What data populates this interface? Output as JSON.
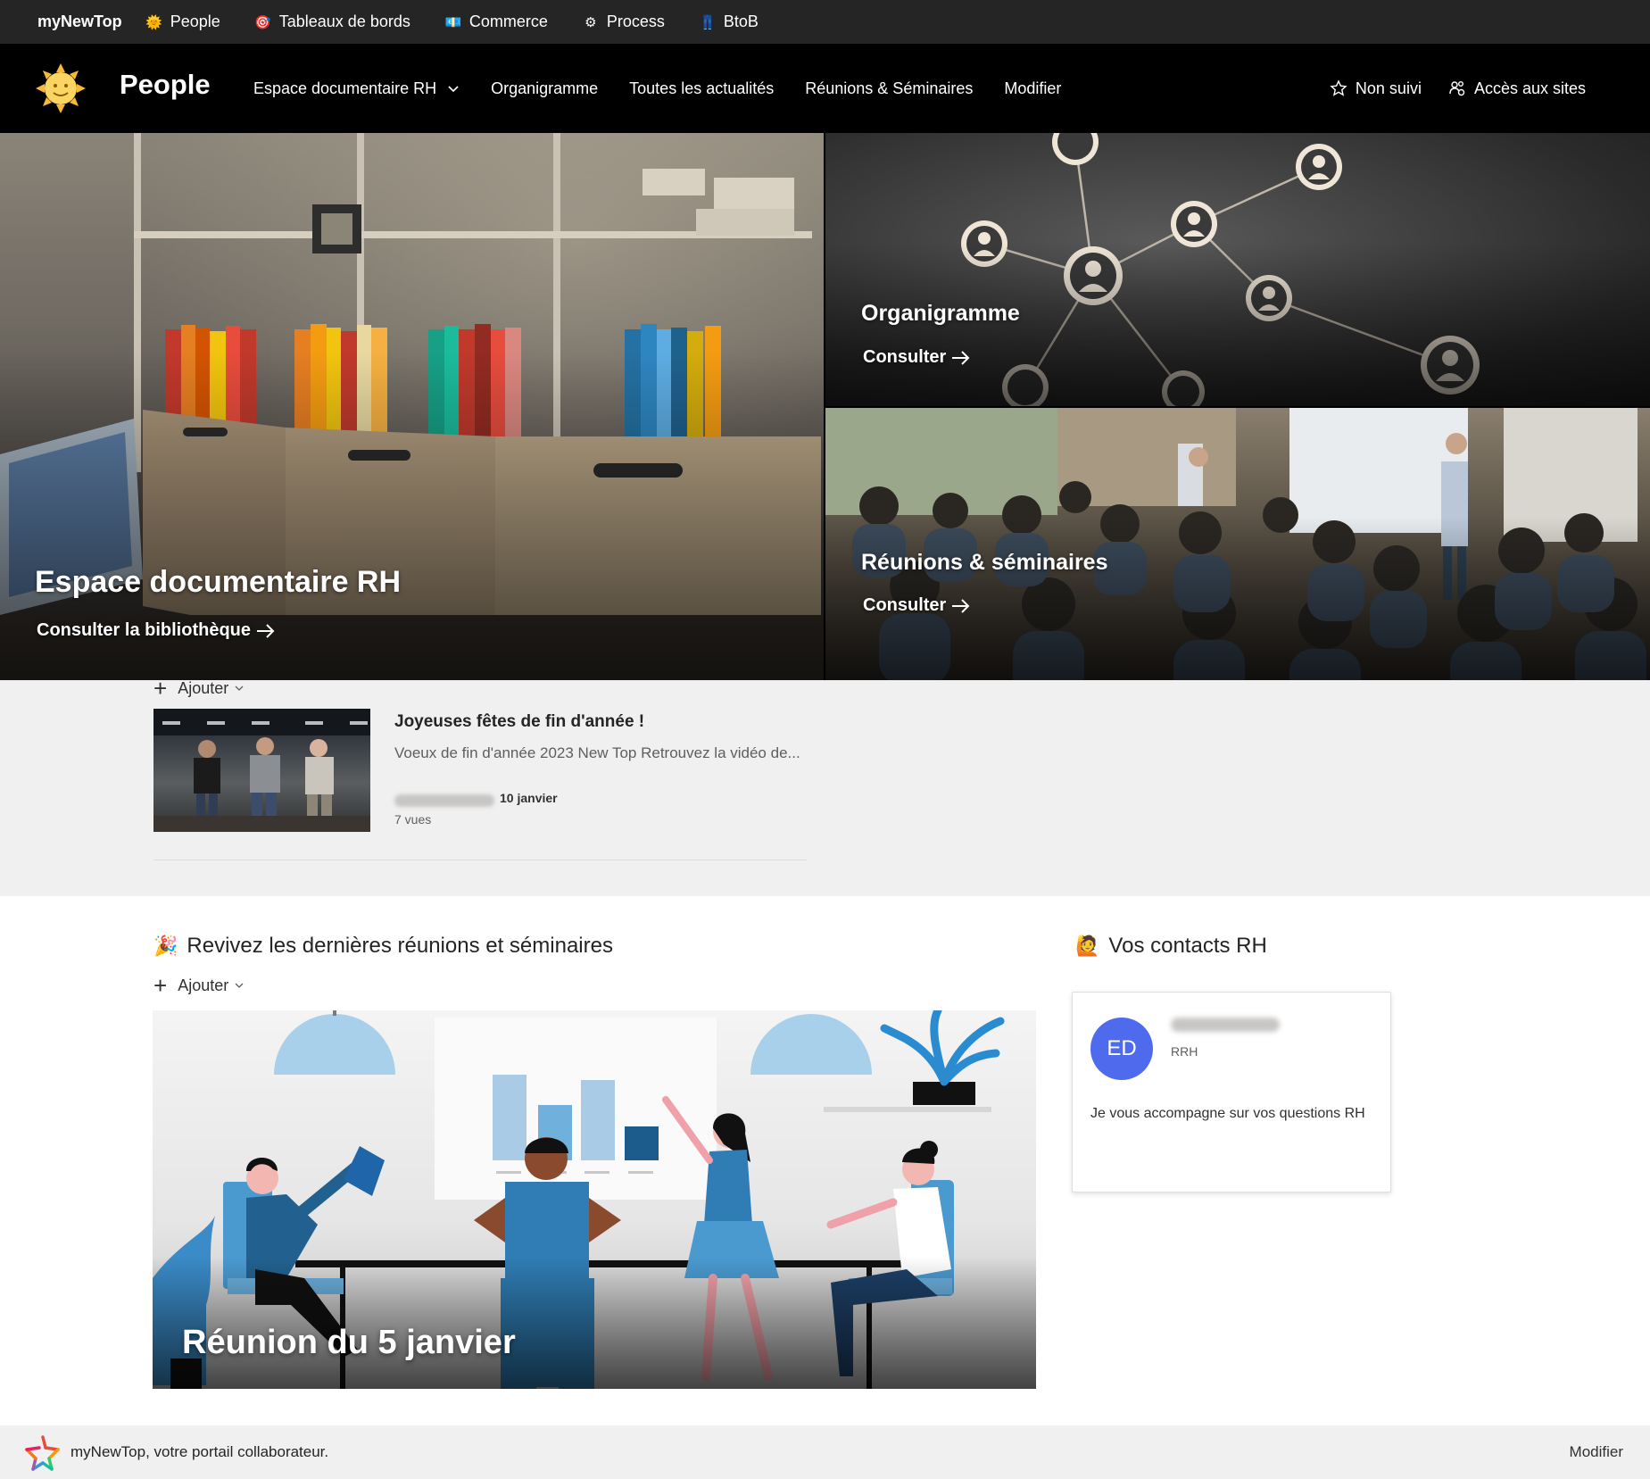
{
  "hub": {
    "brand": "myNewTop",
    "items": [
      {
        "label": "People",
        "icon": "sun-face-icon",
        "emoji": "🌞"
      },
      {
        "label": "Tableaux de bords",
        "icon": "target-icon",
        "emoji": "🎯"
      },
      {
        "label": "Commerce",
        "icon": "commerce-icon",
        "emoji": "💶"
      },
      {
        "label": "Process",
        "icon": "gears-icon",
        "emoji": "⚙"
      },
      {
        "label": "BtoB",
        "icon": "btob-icon",
        "emoji": "👖"
      }
    ]
  },
  "site": {
    "title": "People",
    "nav": [
      {
        "label": "Espace documentaire RH",
        "has_dropdown": true
      },
      {
        "label": "Organigramme"
      },
      {
        "label": "Toutes les actualités"
      },
      {
        "label": "Réunions & Séminaires"
      },
      {
        "label": "Modifier"
      }
    ],
    "follow_label": "Non suivi",
    "sites_label": "Accès aux sites"
  },
  "hero": {
    "main": {
      "title": "Espace documentaire RH",
      "link": "Consulter la bibliothèque"
    },
    "org": {
      "title": "Organigramme",
      "link": "Consulter"
    },
    "meetings": {
      "title": "Réunions & séminaires",
      "link": "Consulter"
    }
  },
  "news": {
    "add_label": "Ajouter",
    "item": {
      "title": "Joyeuses fêtes de fin d'année !",
      "description": "Voeux de fin d'année 2023 New Top Retrouvez la vidéo de...",
      "date": "10 janvier",
      "views": "7 vues"
    }
  },
  "meetings_section": {
    "emoji": "🎉",
    "title": "Revivez les dernières réunions et séminaires",
    "add_label": "Ajouter",
    "card_title": "Réunion du 5 janvier"
  },
  "contacts": {
    "emoji": "🙋",
    "title": "Vos contacts RH",
    "card": {
      "initials": "ED",
      "role": "RRH",
      "text": "Je vous accompagne sur vos questions RH",
      "avatar_color": "#4f6bed"
    }
  },
  "footer": {
    "text": "myNewTop, votre portail collaborateur.",
    "edit_label": "Modifier"
  }
}
